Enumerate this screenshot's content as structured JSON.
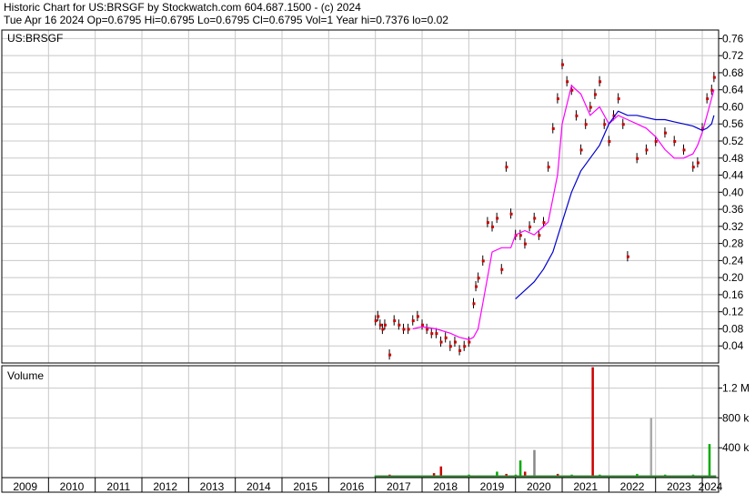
{
  "header": {
    "title_line": "Historic Chart for US:BRSGF by Stockwatch.com 604.687.1500 - (c) 2024",
    "quote_line": "Tue Apr 16 2024   Op=0.6795   Hi=0.6795   Lo=0.6795   Cl=0.6795   Vol=1   Year hi=0.7376   lo=0.02"
  },
  "chart_data": [
    {
      "type": "line",
      "panel": "price",
      "title": "US:BRSGF",
      "ylim": [
        0,
        0.78
      ],
      "yticks": [
        "0.76",
        "0.72",
        "0.68",
        "0.64",
        "0.60",
        "0.56",
        "0.52",
        "0.48",
        "0.44",
        "0.40",
        "0.36",
        "0.32",
        "0.28",
        "0.24",
        "0.20",
        "0.16",
        "0.12",
        "0.08",
        "0.04"
      ],
      "xticks": [
        "2009",
        "2010",
        "2011",
        "2012",
        "2013",
        "2014",
        "2015",
        "2016",
        "2017",
        "2018",
        "2019",
        "2020",
        "2021",
        "2022",
        "2023",
        "2024"
      ],
      "xlim": [
        2009.0,
        2024.35
      ],
      "grid": true,
      "colors": {
        "price": "#cc0000",
        "bar": "#000000",
        "fast_ma": "#ff00ff",
        "slow_ma": "#0000cc"
      },
      "series": [
        {
          "style": "points",
          "x": [
            2017.0,
            2017.05,
            2017.1,
            2017.15,
            2017.2,
            2017.3,
            2017.4,
            2017.5,
            2017.6,
            2017.7,
            2017.8,
            2017.9,
            2018.0,
            2018.1,
            2018.2,
            2018.3,
            2018.4,
            2018.5,
            2018.6,
            2018.7,
            2018.8,
            2018.9,
            2019.0,
            2019.1,
            2019.15,
            2019.2,
            2019.3,
            2019.4,
            2019.5,
            2019.6,
            2019.7,
            2019.8,
            2019.9,
            2020.0,
            2020.1,
            2020.2,
            2020.3,
            2020.4,
            2020.5,
            2020.6,
            2020.7,
            2020.8,
            2020.9,
            2021.0,
            2021.1,
            2021.2,
            2021.3,
            2021.4,
            2021.5,
            2021.6,
            2021.7,
            2021.8,
            2021.9,
            2022.0,
            2022.1,
            2022.2,
            2022.3,
            2022.4,
            2022.6,
            2022.8,
            2023.0,
            2023.2,
            2023.4,
            2023.6,
            2023.8,
            2023.9,
            2024.0,
            2024.1,
            2024.2,
            2024.25
          ],
          "values": [
            0.1,
            0.11,
            0.09,
            0.08,
            0.09,
            0.02,
            0.1,
            0.09,
            0.08,
            0.08,
            0.1,
            0.11,
            0.09,
            0.08,
            0.07,
            0.07,
            0.05,
            0.06,
            0.04,
            0.05,
            0.03,
            0.04,
            0.05,
            0.14,
            0.18,
            0.2,
            0.24,
            0.33,
            0.32,
            0.34,
            0.22,
            0.46,
            0.35,
            0.3,
            0.3,
            0.28,
            0.32,
            0.34,
            0.3,
            0.33,
            0.46,
            0.55,
            0.62,
            0.7,
            0.66,
            0.64,
            0.58,
            0.5,
            0.56,
            0.6,
            0.63,
            0.66,
            0.56,
            0.52,
            0.58,
            0.62,
            0.56,
            0.25,
            0.48,
            0.5,
            0.52,
            0.54,
            0.52,
            0.5,
            0.46,
            0.47,
            0.55,
            0.62,
            0.64,
            0.67
          ]
        },
        {
          "name": "fast_ma",
          "style": "line",
          "x": [
            2017.8,
            2018.0,
            2018.3,
            2018.6,
            2018.8,
            2019.0,
            2019.1,
            2019.2,
            2019.3,
            2019.5,
            2019.7,
            2019.9,
            2020.0,
            2020.2,
            2020.4,
            2020.5,
            2020.7,
            2020.9,
            2021.0,
            2021.2,
            2021.4,
            2021.6,
            2021.8,
            2022.0,
            2022.2,
            2022.4,
            2022.6,
            2022.8,
            2023.0,
            2023.2,
            2023.4,
            2023.6,
            2023.8,
            2023.9,
            2024.0,
            2024.1,
            2024.2,
            2024.25
          ],
          "values": [
            0.08,
            0.085,
            0.08,
            0.07,
            0.06,
            0.055,
            0.06,
            0.08,
            0.14,
            0.26,
            0.27,
            0.27,
            0.3,
            0.31,
            0.3,
            0.31,
            0.33,
            0.44,
            0.56,
            0.65,
            0.63,
            0.58,
            0.6,
            0.56,
            0.58,
            0.57,
            0.56,
            0.55,
            0.53,
            0.5,
            0.48,
            0.48,
            0.49,
            0.51,
            0.54,
            0.58,
            0.62,
            0.64
          ]
        },
        {
          "name": "slow_ma",
          "style": "line",
          "x": [
            2020.0,
            2020.2,
            2020.4,
            2020.6,
            2020.8,
            2021.0,
            2021.2,
            2021.4,
            2021.6,
            2021.8,
            2022.0,
            2022.2,
            2022.4,
            2022.6,
            2022.8,
            2023.0,
            2023.2,
            2023.4,
            2023.6,
            2023.8,
            2023.9,
            2024.0,
            2024.1,
            2024.2,
            2024.25
          ],
          "values": [
            0.15,
            0.17,
            0.19,
            0.22,
            0.26,
            0.33,
            0.4,
            0.45,
            0.48,
            0.51,
            0.56,
            0.59,
            0.58,
            0.58,
            0.575,
            0.57,
            0.57,
            0.565,
            0.56,
            0.555,
            0.55,
            0.545,
            0.55,
            0.56,
            0.58
          ]
        }
      ]
    },
    {
      "type": "bar",
      "panel": "volume",
      "title": "Volume",
      "ylim": [
        0,
        1500000
      ],
      "yticks": [
        "1.2 M",
        "800 k",
        "400 k"
      ],
      "ytick_values": [
        1200000,
        800000,
        400000
      ],
      "grid": true,
      "series": [
        {
          "x": [
            2017.0,
            2017.3,
            2017.6,
            2017.9,
            2018.1,
            2018.25,
            2018.4,
            2018.7,
            2019.0,
            2019.3,
            2019.6,
            2019.8,
            2020.0,
            2020.1,
            2020.2,
            2020.4,
            2020.6,
            2020.9,
            2021.2,
            2021.5,
            2021.65,
            2021.8,
            2022.2,
            2022.6,
            2022.9,
            2023.2,
            2023.5,
            2023.8,
            2024.0,
            2024.15
          ],
          "values": [
            30000,
            40000,
            20000,
            30000,
            20000,
            60000,
            150000,
            30000,
            40000,
            30000,
            80000,
            50000,
            40000,
            230000,
            80000,
            370000,
            30000,
            50000,
            40000,
            30000,
            1480000,
            40000,
            30000,
            50000,
            800000,
            40000,
            30000,
            40000,
            30000,
            450000
          ],
          "colors": [
            "#00aa00",
            "#cc0000",
            "#00aa00",
            "#cc0000",
            "#00aa00",
            "#cc0000",
            "#cc0000",
            "#00aa00",
            "#00aa00",
            "#cc0000",
            "#00aa00",
            "#cc0000",
            "#00aa00",
            "#00aa00",
            "#cc0000",
            "#888888",
            "#00aa00",
            "#cc0000",
            "#00aa00",
            "#00aa00",
            "#cc0000",
            "#00aa00",
            "#cc0000",
            "#00aa00",
            "#aaaaaa",
            "#00aa00",
            "#cc0000",
            "#00aa00",
            "#cc0000",
            "#00aa00"
          ]
        }
      ]
    }
  ]
}
